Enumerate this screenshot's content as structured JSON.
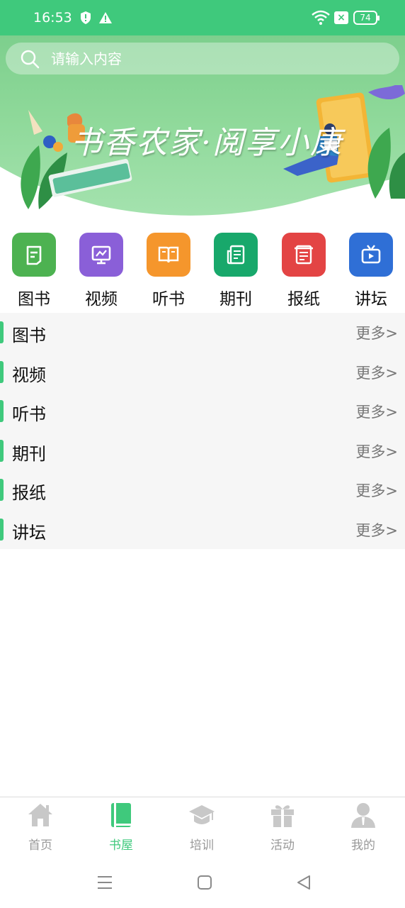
{
  "status_bar": {
    "time": "16:53",
    "battery": "74",
    "icons": [
      "shield-icon",
      "warning-icon",
      "wifi-icon",
      "sim-blocked-icon",
      "battery-icon"
    ]
  },
  "search": {
    "placeholder": "请输入内容"
  },
  "banner": {
    "title": "书香农家·阅享小康"
  },
  "categories": [
    {
      "label": "图书",
      "color": "#4db251",
      "icon": "book-icon"
    },
    {
      "label": "视频",
      "color": "#8a5fd8",
      "icon": "video-monitor-icon"
    },
    {
      "label": "听书",
      "color": "#f5962c",
      "icon": "open-book-icon"
    },
    {
      "label": "期刊",
      "color": "#18a86b",
      "icon": "journal-icon"
    },
    {
      "label": "报纸",
      "color": "#e34444",
      "icon": "newspaper-icon"
    },
    {
      "label": "讲坛",
      "color": "#2f6fd6",
      "icon": "tv-icon"
    }
  ],
  "sections": [
    {
      "title": "图书",
      "more": "更多>"
    },
    {
      "title": "视频",
      "more": "更多>"
    },
    {
      "title": "听书",
      "more": "更多>"
    },
    {
      "title": "期刊",
      "more": "更多>"
    },
    {
      "title": "报纸",
      "more": "更多>"
    },
    {
      "title": "讲坛",
      "more": "更多>"
    }
  ],
  "bottom_nav": [
    {
      "label": "首页",
      "icon": "home-icon",
      "active": false
    },
    {
      "label": "书屋",
      "icon": "bookshelf-icon",
      "active": true
    },
    {
      "label": "培训",
      "icon": "graduation-cap-icon",
      "active": false
    },
    {
      "label": "活动",
      "icon": "gift-icon",
      "active": false
    },
    {
      "label": "我的",
      "icon": "user-icon",
      "active": false
    }
  ],
  "colors": {
    "accent": "#3fc97c",
    "inactive": "#c8c8c8"
  }
}
